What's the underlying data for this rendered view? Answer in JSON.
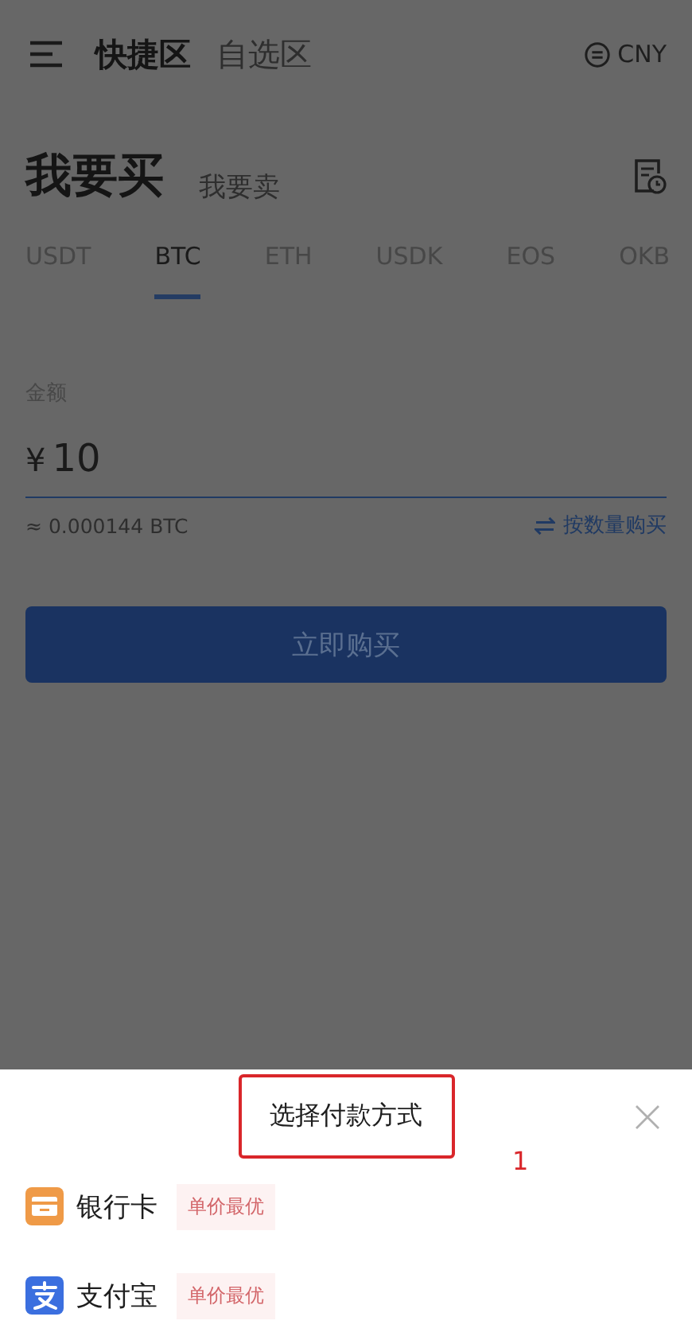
{
  "header": {
    "tabs": [
      {
        "label": "快捷区",
        "selected": true
      },
      {
        "label": "自选区",
        "selected": false
      }
    ],
    "currency": "CNY"
  },
  "trade_tabs": [
    {
      "label": "我要买",
      "selected": true
    },
    {
      "label": "我要卖",
      "selected": false
    }
  ],
  "coins": [
    {
      "label": "USDT",
      "selected": false
    },
    {
      "label": "BTC",
      "selected": true
    },
    {
      "label": "ETH",
      "selected": false
    },
    {
      "label": "USDK",
      "selected": false
    },
    {
      "label": "EOS",
      "selected": false
    },
    {
      "label": "OKB",
      "selected": false
    }
  ],
  "amount": {
    "label": "金额",
    "currency_symbol": "¥",
    "value": "10"
  },
  "estimate": "≈ 0.000144 BTC",
  "switch_link": "按数量购买",
  "buy_button": "立即购买",
  "sheet": {
    "title": "选择付款方式",
    "annotation": "1",
    "methods": [
      {
        "name": "银行卡",
        "kind": "bank-card",
        "tag": "单价最优"
      },
      {
        "name": "支付宝",
        "kind": "alipay",
        "tag": "单价最优"
      }
    ]
  }
}
